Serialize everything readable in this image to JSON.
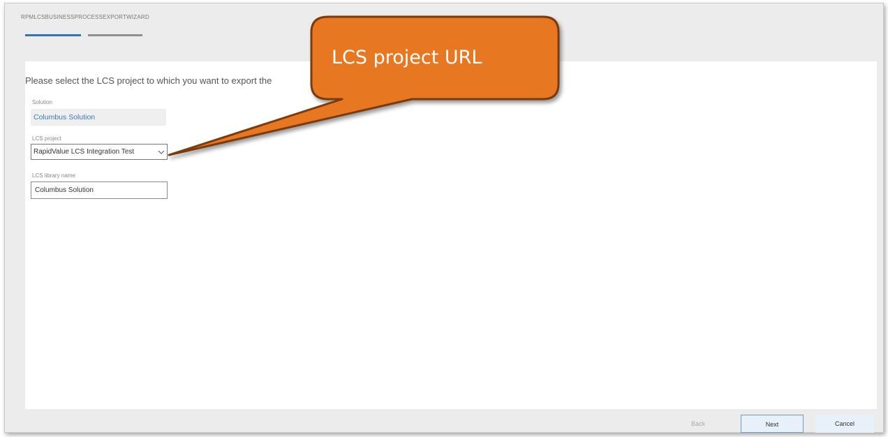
{
  "wizard": {
    "title": "RPMLCSBUSINESSPROCESSEXPORTWIZARD",
    "prompt": "Please select the LCS project to which you want to export the"
  },
  "form": {
    "solution_label": "Solution",
    "solution_value": "Columbus Solution",
    "lcs_project_label": "LCS project",
    "lcs_project_value": "RapidValue LCS Integration Test",
    "library_label": "LCS library name",
    "library_value": "Columbus Solution"
  },
  "footer": {
    "back_label": "Back",
    "next_label": "Next",
    "cancel_label": "Cancel"
  },
  "callout": {
    "text": "LCS project URL",
    "fill_color": "#e87722",
    "border_color": "#7a3a10"
  },
  "colors": {
    "progress_active": "#2f74c0",
    "progress_inactive": "#8f8f8f",
    "link_text": "#3a79bf"
  },
  "icons": {
    "dropdown": "chevron-down-icon"
  }
}
